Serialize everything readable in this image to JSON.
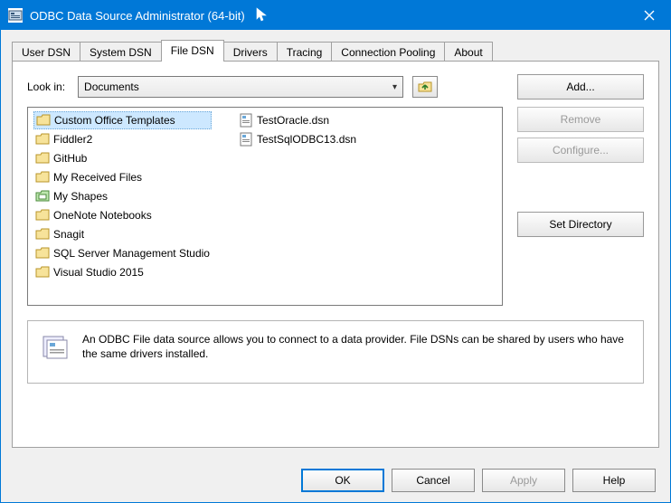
{
  "window": {
    "title": "ODBC Data Source Administrator (64-bit)"
  },
  "tabs": [
    {
      "label": "User DSN",
      "active": false
    },
    {
      "label": "System DSN",
      "active": false
    },
    {
      "label": "File DSN",
      "active": true
    },
    {
      "label": "Drivers",
      "active": false
    },
    {
      "label": "Tracing",
      "active": false
    },
    {
      "label": "Connection Pooling",
      "active": false
    },
    {
      "label": "About",
      "active": false
    }
  ],
  "lookin": {
    "label": "Look in:",
    "value": "Documents"
  },
  "list": {
    "col1": [
      {
        "name": "Custom Office Templates",
        "type": "folder",
        "selected": true
      },
      {
        "name": "Fiddler2",
        "type": "folder"
      },
      {
        "name": "GitHub",
        "type": "folder"
      },
      {
        "name": "My Received Files",
        "type": "folder"
      },
      {
        "name": "My Shapes",
        "type": "folder-special"
      },
      {
        "name": "OneNote Notebooks",
        "type": "folder"
      },
      {
        "name": "Snagit",
        "type": "folder"
      },
      {
        "name": "SQL Server Management Studio",
        "type": "folder"
      },
      {
        "name": "Visual Studio 2015",
        "type": "folder"
      }
    ],
    "col2": [
      {
        "name": "TestOracle.dsn",
        "type": "dsn"
      },
      {
        "name": "TestSqlODBC13.dsn",
        "type": "dsn"
      }
    ]
  },
  "buttons": {
    "add": "Add...",
    "remove": "Remove",
    "configure": "Configure...",
    "setdir": "Set Directory"
  },
  "info": "An ODBC File data source allows you to connect to a data provider.  File DSNs can be shared by users who have the same drivers installed.",
  "dialog": {
    "ok": "OK",
    "cancel": "Cancel",
    "apply": "Apply",
    "help": "Help"
  }
}
